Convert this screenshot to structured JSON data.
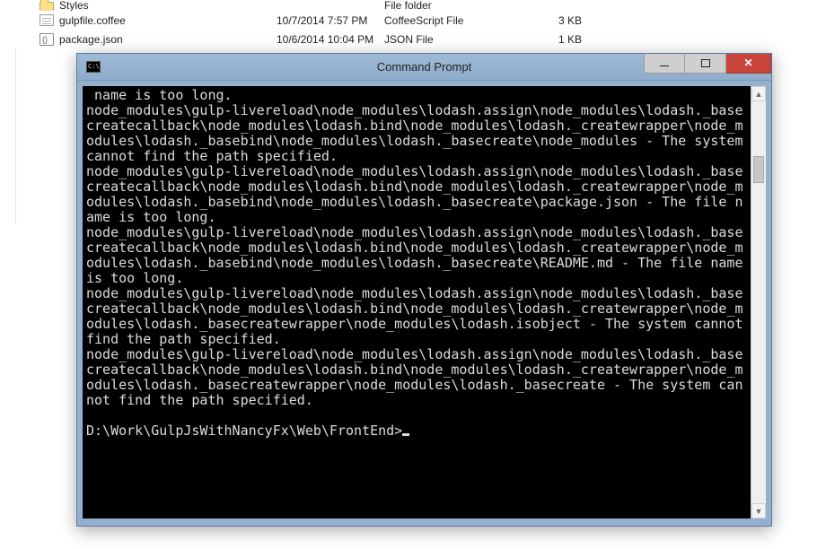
{
  "explorer": {
    "rows": [
      {
        "icon": "folder",
        "name": "Styles",
        "date": "",
        "type": "File folder",
        "size": ""
      },
      {
        "icon": "file",
        "name": "gulpfile.coffee",
        "date": "10/7/2014 7:57 PM",
        "type": "CoffeeScript File",
        "size": "3 KB"
      },
      {
        "icon": "json",
        "name": "package.json",
        "date": "10/6/2014 10:04 PM",
        "type": "JSON File",
        "size": "1 KB"
      }
    ]
  },
  "cmd": {
    "title": "Command Prompt",
    "lines": [
      " name is too long.",
      "node_modules\\gulp-livereload\\node_modules\\lodash.assign\\node_modules\\lodash._basecreatecallback\\node_modules\\lodash.bind\\node_modules\\lodash._createwrapper\\node_modules\\lodash._basebind\\node_modules\\lodash._basecreate\\node_modules - The system cannot find the path specified.",
      "node_modules\\gulp-livereload\\node_modules\\lodash.assign\\node_modules\\lodash._basecreatecallback\\node_modules\\lodash.bind\\node_modules\\lodash._createwrapper\\node_modules\\lodash._basebind\\node_modules\\lodash._basecreate\\package.json - The file name is too long.",
      "node_modules\\gulp-livereload\\node_modules\\lodash.assign\\node_modules\\lodash._basecreatecallback\\node_modules\\lodash.bind\\node_modules\\lodash._createwrapper\\node_modules\\lodash._basebind\\node_modules\\lodash._basecreate\\README.md - The file name is too long.",
      "node_modules\\gulp-livereload\\node_modules\\lodash.assign\\node_modules\\lodash._basecreatecallback\\node_modules\\lodash.bind\\node_modules\\lodash._createwrapper\\node_modules\\lodash._basecreatewrapper\\node_modules\\lodash.isobject - The system cannot find the path specified.",
      "node_modules\\gulp-livereload\\node_modules\\lodash.assign\\node_modules\\lodash._basecreatecallback\\node_modules\\lodash.bind\\node_modules\\lodash._createwrapper\\node_modules\\lodash._basecreatewrapper\\node_modules\\lodash._basecreate - The system cannot find the path specified.",
      ""
    ],
    "prompt": "D:\\Work\\GulpJsWithNancyFx\\Web\\FrontEnd>"
  }
}
